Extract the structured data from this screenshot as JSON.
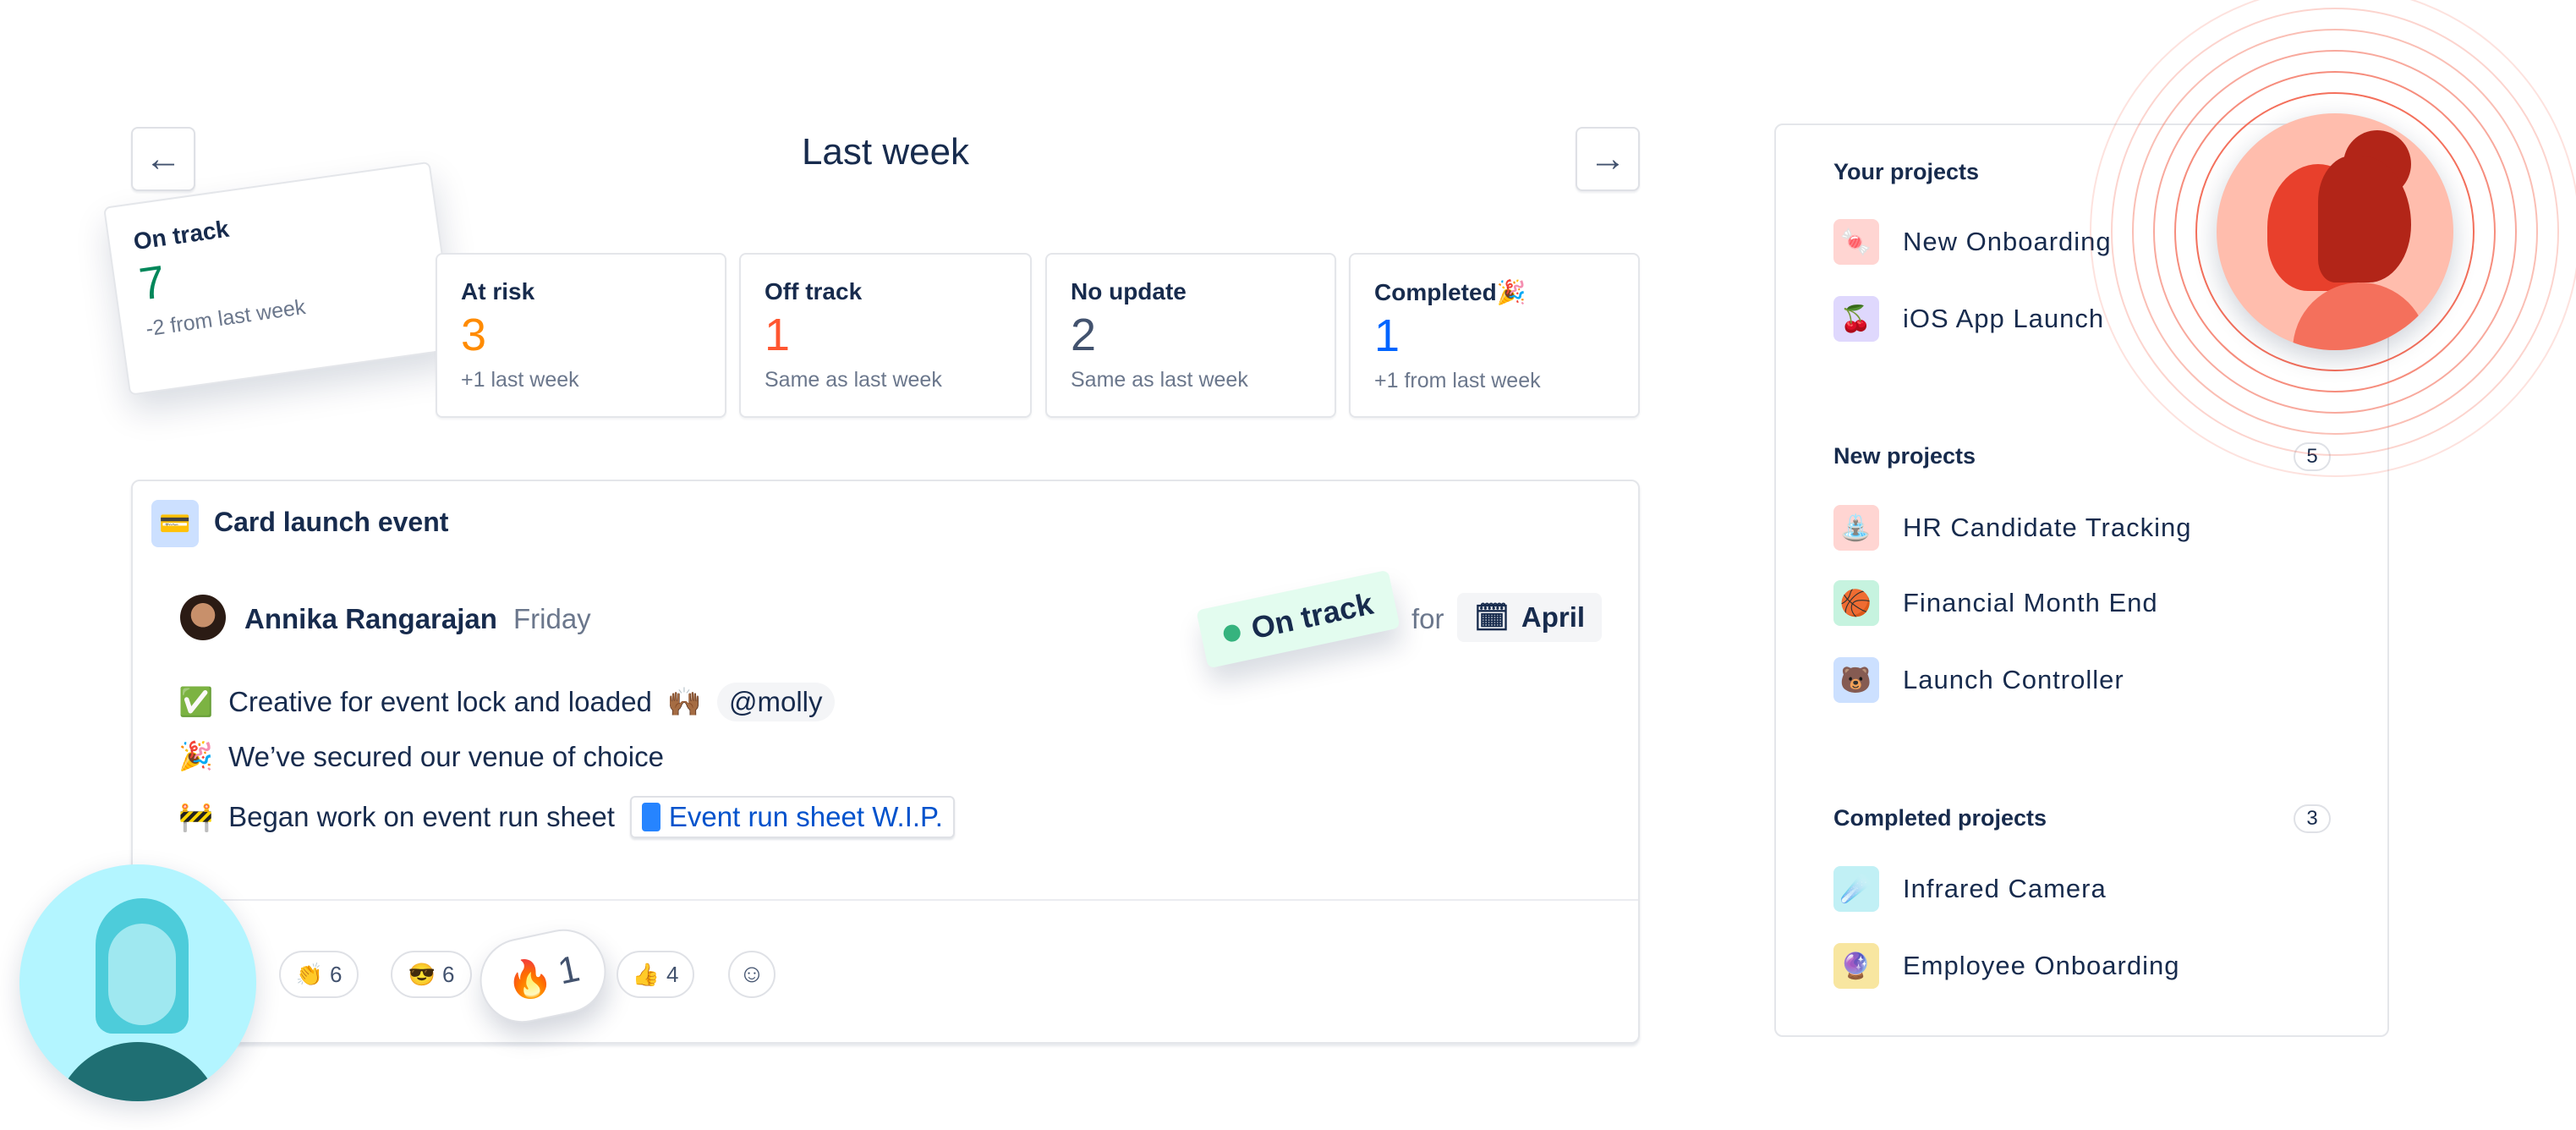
{
  "header": {
    "title": "Last week",
    "prev_icon": "arrow-left-icon",
    "next_icon": "arrow-right-icon"
  },
  "stats": [
    {
      "label": "On track",
      "value": "7",
      "sub": "-2 from last week",
      "color": "#00875A"
    },
    {
      "label": "At risk",
      "value": "3",
      "sub": "+1 last week",
      "color": "#FF8B00"
    },
    {
      "label": "Off track",
      "value": "1",
      "sub": "Same as last week",
      "color": "#FF5630"
    },
    {
      "label": "No update",
      "value": "2",
      "sub": "Same as last week",
      "color": "#42526E"
    },
    {
      "label": "Completed",
      "emoji": "🎉",
      "value": "1",
      "sub": "+1 from last week",
      "color": "#0065FF"
    }
  ],
  "update": {
    "project_icon": "💳",
    "project": "Card launch event",
    "author": "Annika Rangarajan",
    "day": "Friday",
    "status": "On track",
    "status_color": "#36B37E",
    "for": "for",
    "target": "April",
    "lines": [
      {
        "icon": "✅",
        "text": "Creative for event lock and loaded",
        "emoji": "🙌🏾",
        "mention": "@molly"
      },
      {
        "icon": "🎉",
        "text": "We’ve secured our venue of choice"
      },
      {
        "icon": "🚧",
        "text": "Began work on event run sheet",
        "link": "Event run sheet W.I.P."
      }
    ],
    "reactions": [
      {
        "emoji": "👏",
        "count": "6"
      },
      {
        "emoji": "😎",
        "count": "6"
      },
      {
        "emoji": "🔥",
        "count": "1"
      },
      {
        "emoji": "👍",
        "count": "4"
      }
    ],
    "add_reaction_icon": "smiley-add-icon"
  },
  "sidebar": {
    "your": {
      "title": "Your projects",
      "items": [
        {
          "icon": "🍬",
          "label": "New Onboarding",
          "bg": "#FFD5D2"
        },
        {
          "icon": "🍒",
          "label": "iOS App Launch",
          "bg": "#DFD8FD"
        }
      ]
    },
    "new": {
      "title": "New projects",
      "count": "5",
      "items": [
        {
          "icon": "⛲",
          "label": "HR Candidate Tracking",
          "bg": "#FFD5D2"
        },
        {
          "icon": "🏀",
          "label": "Financial Month End",
          "bg": "#C6F3DF"
        },
        {
          "icon": "🐻",
          "label": "Launch Controller",
          "bg": "#CCE0FF"
        }
      ]
    },
    "completed": {
      "title": "Completed projects",
      "count": "3",
      "items": [
        {
          "icon": "☄️",
          "label": "Infrared Camera",
          "bg": "#C1F0F5"
        },
        {
          "icon": "🔮",
          "label": "Employee Onboarding",
          "bg": "#F8E6A0"
        }
      ]
    }
  }
}
